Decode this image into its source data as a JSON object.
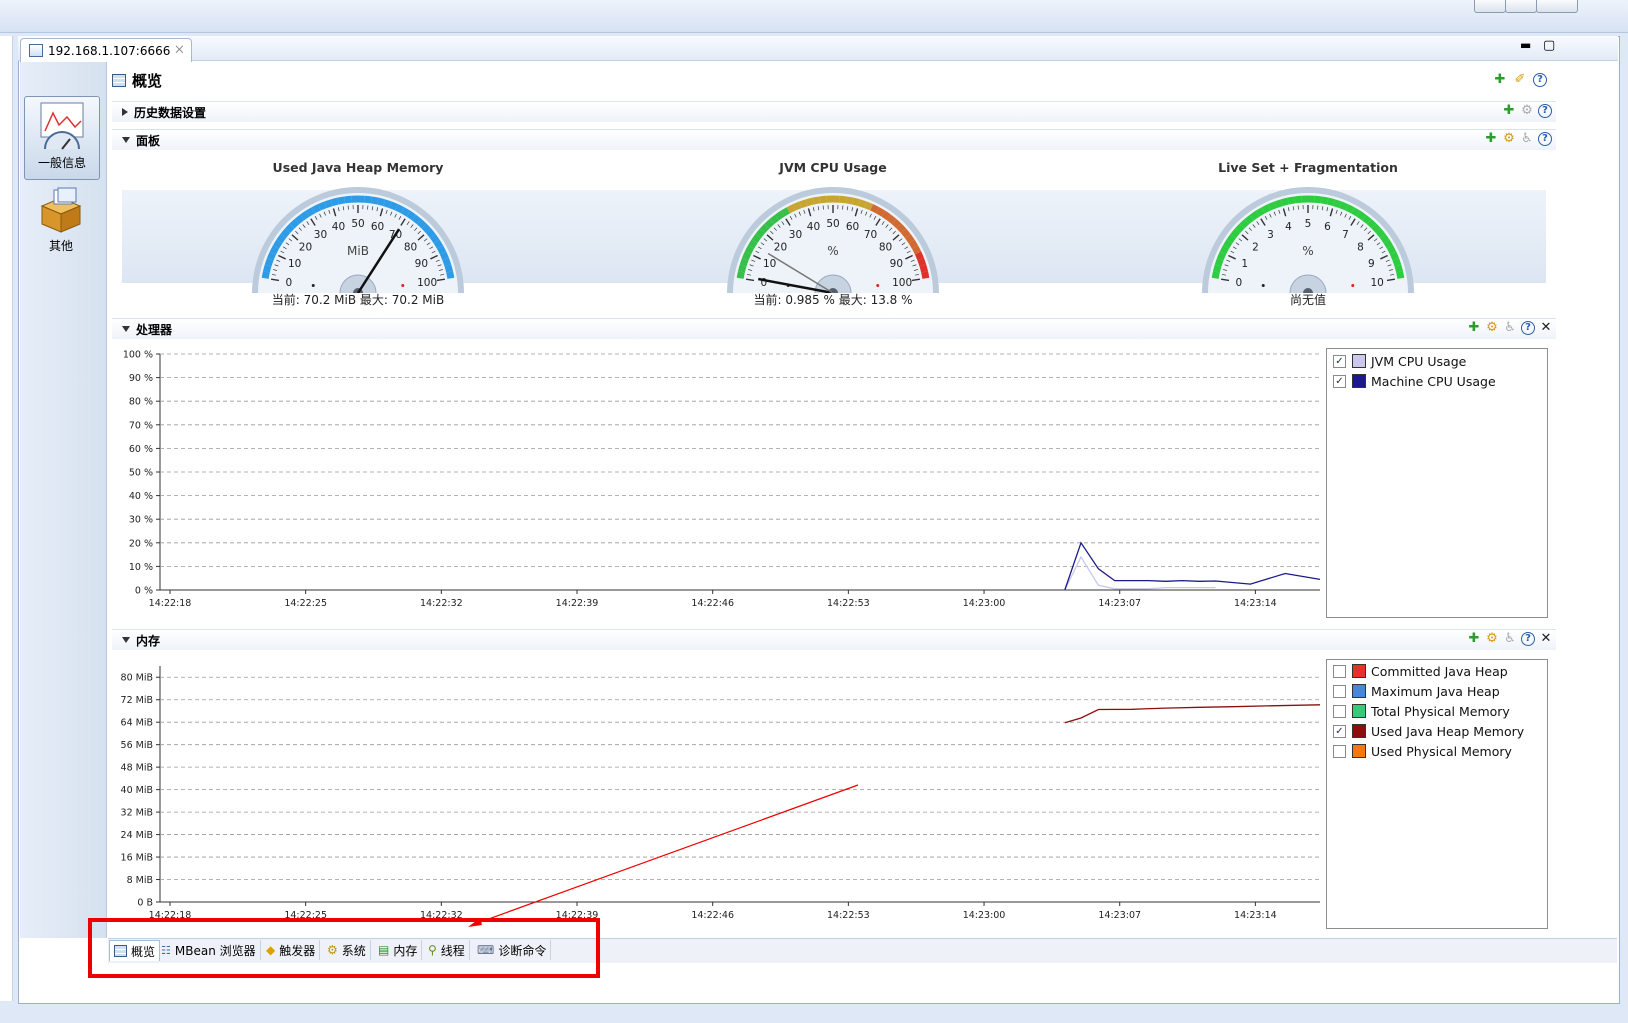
{
  "editor_tab": {
    "title": "192.168.1.107:6666",
    "close": "⨉"
  },
  "side_nav": [
    {
      "label": "一般信息",
      "icon": "chart-gauge-icon",
      "active": true
    },
    {
      "label": "其他",
      "icon": "box-icon",
      "active": false
    }
  ],
  "page": {
    "title": "概览"
  },
  "sections": {
    "history": "历史数据设置",
    "dashboard": "面板",
    "processor": "处理器",
    "memory": "内存"
  },
  "gauges": [
    {
      "title": "Used Java Heap Memory",
      "unit": "MiB",
      "ticks": [
        "0",
        "10",
        "20",
        "30",
        "40",
        "50",
        "60",
        "70",
        "80",
        "90",
        "100"
      ],
      "value": 70.2,
      "max": 100,
      "caption": "当前: 70.2 MiB 最大: 70.2 MiB"
    },
    {
      "title": "JVM CPU Usage",
      "unit": "%",
      "ticks": [
        "0",
        "10",
        "20",
        "30",
        "40",
        "50",
        "60",
        "70",
        "80",
        "90",
        "100"
      ],
      "value": 0.985,
      "max": 100,
      "caption": "当前: 0.985 % 最大: 13.8 %"
    },
    {
      "title": "Live Set + Fragmentation",
      "unit": "%",
      "ticks": [
        "0",
        "1",
        "2",
        "3",
        "4",
        "5",
        "6",
        "7",
        "8",
        "9",
        "10"
      ],
      "value": null,
      "max": 10,
      "caption": "尚无值"
    }
  ],
  "chart_data": [
    {
      "type": "line",
      "name": "processor",
      "x": [
        "14:22:18",
        "14:22:25",
        "14:22:32",
        "14:22:39",
        "14:22:46",
        "14:22:53",
        "14:23:00",
        "14:23:07",
        "14:23:14"
      ],
      "y_ticks": [
        "0 %",
        "10 %",
        "20 %",
        "30 %",
        "40 %",
        "50 %",
        "60 %",
        "70 %",
        "80 %",
        "90 %",
        "100 %"
      ],
      "ylim": [
        0,
        100
      ],
      "series": [
        {
          "name": "JVM CPU Usage",
          "color": "#c9c9ee",
          "checked": true,
          "points": [
            [
              0.0,
              0
            ],
            [
              0.014,
              14
            ],
            [
              0.029,
              2
            ],
            [
              0.043,
              0.5
            ],
            [
              0.058,
              0.5
            ],
            [
              0.072,
              0.5
            ],
            [
              0.087,
              1
            ],
            [
              0.101,
              1
            ],
            [
              0.116,
              1
            ],
            [
              0.13,
              1
            ]
          ]
        },
        {
          "name": "Machine CPU Usage",
          "color": "#1a1a8c",
          "checked": true,
          "points": [
            [
              0.0,
              0
            ],
            [
              0.014,
              20
            ],
            [
              0.029,
              9
            ],
            [
              0.043,
              4
            ],
            [
              0.058,
              4
            ],
            [
              0.072,
              4
            ],
            [
              0.087,
              3.7
            ],
            [
              0.101,
              4
            ],
            [
              0.116,
              3.7
            ],
            [
              0.13,
              3.8
            ],
            [
              0.16,
              2.5
            ],
            [
              0.19,
              7
            ],
            [
              0.22,
              4.5
            ]
          ]
        }
      ]
    },
    {
      "type": "line",
      "name": "memory",
      "x": [
        "14:22:18",
        "14:22:25",
        "14:22:32",
        "14:22:39",
        "14:22:46",
        "14:22:53",
        "14:23:00",
        "14:23:07",
        "14:23:14"
      ],
      "y_ticks": [
        "0 B",
        "8 MiB",
        "16 MiB",
        "24 MiB",
        "32 MiB",
        "40 MiB",
        "48 MiB",
        "56 MiB",
        "64 MiB",
        "72 MiB",
        "80 MiB"
      ],
      "ylim": [
        0,
        84
      ],
      "series": [
        {
          "name": "Committed Java Heap",
          "color": "#e53030",
          "checked": false
        },
        {
          "name": "Maximum Java Heap",
          "color": "#4a86d8",
          "checked": false
        },
        {
          "name": "Total Physical Memory",
          "color": "#3cc878",
          "checked": false
        },
        {
          "name": "Used Java Heap Memory",
          "color": "#8b0f0f",
          "checked": true,
          "points": [
            [
              0.0,
              63.8
            ],
            [
              0.014,
              65.5
            ],
            [
              0.029,
              68.5
            ],
            [
              0.058,
              68.6
            ],
            [
              0.087,
              69.0
            ],
            [
              0.116,
              69.3
            ],
            [
              0.145,
              69.5
            ],
            [
              0.174,
              69.8
            ],
            [
              0.22,
              70.2
            ]
          ]
        },
        {
          "name": "Used Physical Memory",
          "color": "#f07a10",
          "checked": false
        }
      ]
    }
  ],
  "bottom_tabs": [
    {
      "label": "概览",
      "icon": "overview-icon",
      "active": true
    },
    {
      "label": "MBean 浏览器",
      "icon": "mbean-icon",
      "active": false
    },
    {
      "label": "触发器",
      "icon": "trigger-icon",
      "active": false
    },
    {
      "label": "系统",
      "icon": "system-icon",
      "active": false
    },
    {
      "label": "内存",
      "icon": "memory-icon",
      "active": false
    },
    {
      "label": "线程",
      "icon": "thread-icon",
      "active": false
    },
    {
      "label": "诊断命令",
      "icon": "diagnostic-icon",
      "active": false
    }
  ]
}
